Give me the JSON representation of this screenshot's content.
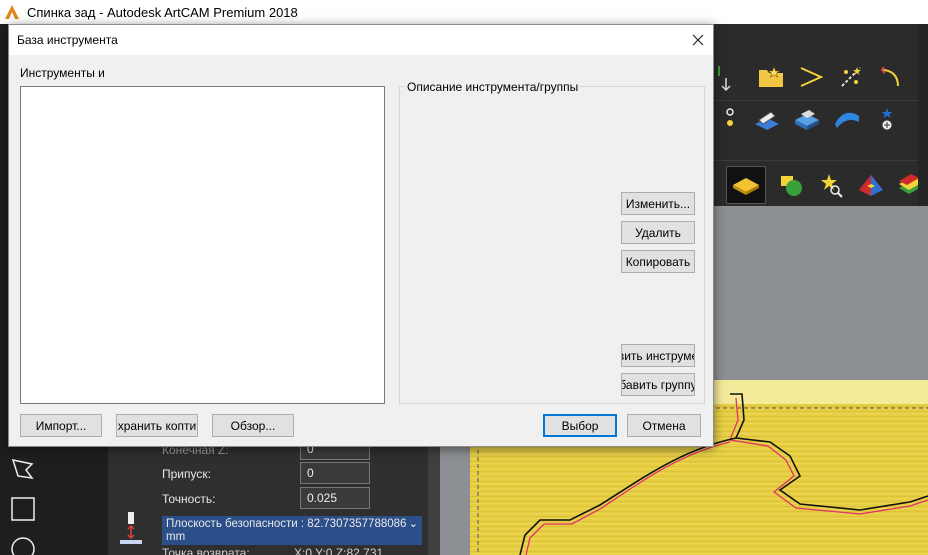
{
  "app": {
    "title": "Спинка зад - Autodesk ArtCAM Premium 2018",
    "icon": "artcam-logo-icon"
  },
  "dialog": {
    "title": "База инструмента",
    "close_icon": "close-icon",
    "tools_label": "Инструменты и",
    "group_legend": "Описание инструмента/группы",
    "buttons": {
      "edit": "Изменить...",
      "delete": "Удалить",
      "copy": "Копировать",
      "add_tool": "вить инструме",
      "add_group": "бавить группу",
      "import": "Импорт...",
      "save_copy": "хранить копти",
      "browse": "Обзор...",
      "select": "Выбор",
      "cancel": "Отмена"
    }
  },
  "panel": {
    "end_z_label": "Конечная Z:",
    "end_z_value": "0",
    "allowance_label": "Припуск:",
    "allowance_value": "0",
    "tolerance_label": "Точность:",
    "tolerance_value": "0.025",
    "safe_plane_text": "Плоскость безопасности : 82.7307357788086 mm",
    "return_label": "Точка возврата:",
    "return_value": "X:0 Y:0 Z:82.731"
  },
  "colors": {
    "accent": "#0078d7",
    "dark_bg": "#2b2b2b",
    "selection": "#2c4f8a",
    "viewport_yellow": "#e3c93b",
    "toolpath_pink": "#e0306a"
  },
  "toolbar_icons": {
    "row1": [
      "folder-star-icon",
      "chevron-vector-icon",
      "star-dots-icon",
      "curve-arrow-icon",
      "spiral-icon"
    ],
    "row2": [
      "drop-icon",
      "edit-surface-icon",
      "relief-block-icon",
      "blue-wave-icon",
      "star-target-icon"
    ],
    "row3": [
      "yellow-diamond-icon",
      "shapes-icon",
      "star-search-icon",
      "pyramid-icon",
      "color-layers-icon"
    ]
  },
  "side_icons": [
    "polygon-select-icon",
    "rectangle-icon",
    "circle-icon"
  ]
}
